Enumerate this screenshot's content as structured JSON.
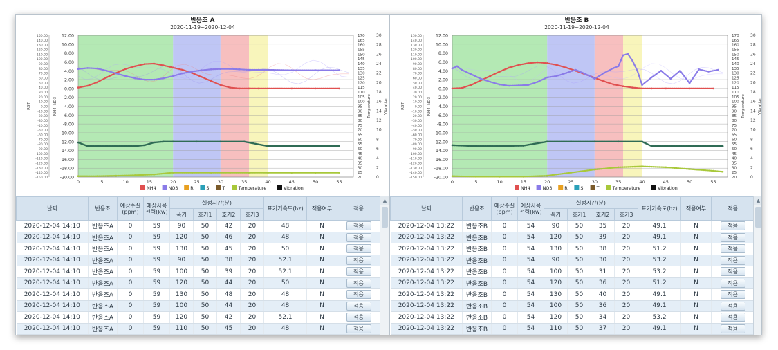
{
  "panels": [
    {
      "chart": {
        "title": "반응조 A",
        "subtitle": "2020-11-19~2020-12-04",
        "y_left_outer_label": "RST",
        "y_left_inner_label": "NH4, NO3",
        "y_right_inner_label": "Temperature",
        "y_right_outer_label": "Vibration"
      },
      "rows": [
        {
          "date": "2020-12-04 14:10",
          "tank": "반응조A",
          "quality": "0",
          "power": "59",
          "aer": "90",
          "anox1": "50",
          "anox2": "42",
          "anox3": "20",
          "freq": "48",
          "applied": "N"
        },
        {
          "date": "2020-12-04 14:10",
          "tank": "반응조A",
          "quality": "0",
          "power": "59",
          "aer": "120",
          "anox1": "50",
          "anox2": "46",
          "anox3": "20",
          "freq": "48",
          "applied": "N"
        },
        {
          "date": "2020-12-04 14:10",
          "tank": "반응조A",
          "quality": "0",
          "power": "59",
          "aer": "130",
          "anox1": "50",
          "anox2": "45",
          "anox3": "20",
          "freq": "50",
          "applied": "N"
        },
        {
          "date": "2020-12-04 14:10",
          "tank": "반응조A",
          "quality": "0",
          "power": "59",
          "aer": "90",
          "anox1": "50",
          "anox2": "38",
          "anox3": "20",
          "freq": "52.1",
          "applied": "N"
        },
        {
          "date": "2020-12-04 14:10",
          "tank": "반응조A",
          "quality": "0",
          "power": "59",
          "aer": "100",
          "anox1": "50",
          "anox2": "39",
          "anox3": "20",
          "freq": "52.1",
          "applied": "N"
        },
        {
          "date": "2020-12-04 14:10",
          "tank": "반응조A",
          "quality": "0",
          "power": "59",
          "aer": "120",
          "anox1": "50",
          "anox2": "44",
          "anox3": "20",
          "freq": "50",
          "applied": "N"
        },
        {
          "date": "2020-12-04 14:10",
          "tank": "반응조A",
          "quality": "0",
          "power": "59",
          "aer": "130",
          "anox1": "50",
          "anox2": "48",
          "anox3": "20",
          "freq": "48",
          "applied": "N"
        },
        {
          "date": "2020-12-04 14:10",
          "tank": "반응조A",
          "quality": "0",
          "power": "59",
          "aer": "100",
          "anox1": "50",
          "anox2": "44",
          "anox3": "20",
          "freq": "48",
          "applied": "N"
        },
        {
          "date": "2020-12-04 14:10",
          "tank": "반응조A",
          "quality": "0",
          "power": "59",
          "aer": "120",
          "anox1": "50",
          "anox2": "42",
          "anox3": "20",
          "freq": "52.1",
          "applied": "N"
        },
        {
          "date": "2020-12-04 14:10",
          "tank": "반응조A",
          "quality": "0",
          "power": "59",
          "aer": "110",
          "anox1": "50",
          "anox2": "45",
          "anox3": "20",
          "freq": "48",
          "applied": "N"
        }
      ]
    },
    {
      "chart": {
        "title": "반응조 B",
        "subtitle": "2020-11-19~2020-12-04",
        "y_left_outer_label": "RST",
        "y_left_inner_label": "NH4, NO3",
        "y_right_inner_label": "Temperature",
        "y_right_outer_label": "Vibration"
      },
      "rows": [
        {
          "date": "2020-12-04 13:22",
          "tank": "반응조B",
          "quality": "0",
          "power": "54",
          "aer": "90",
          "anox1": "50",
          "anox2": "35",
          "anox3": "20",
          "freq": "49.1",
          "applied": "N"
        },
        {
          "date": "2020-12-04 13:22",
          "tank": "반응조B",
          "quality": "0",
          "power": "54",
          "aer": "120",
          "anox1": "50",
          "anox2": "39",
          "anox3": "20",
          "freq": "49.1",
          "applied": "N"
        },
        {
          "date": "2020-12-04 13:22",
          "tank": "반응조B",
          "quality": "0",
          "power": "54",
          "aer": "130",
          "anox1": "50",
          "anox2": "38",
          "anox3": "20",
          "freq": "51.2",
          "applied": "N"
        },
        {
          "date": "2020-12-04 13:22",
          "tank": "반응조B",
          "quality": "0",
          "power": "54",
          "aer": "90",
          "anox1": "50",
          "anox2": "30",
          "anox3": "20",
          "freq": "53.2",
          "applied": "N"
        },
        {
          "date": "2020-12-04 13:22",
          "tank": "반응조B",
          "quality": "0",
          "power": "54",
          "aer": "100",
          "anox1": "50",
          "anox2": "31",
          "anox3": "20",
          "freq": "53.2",
          "applied": "N"
        },
        {
          "date": "2020-12-04 13:22",
          "tank": "반응조B",
          "quality": "0",
          "power": "54",
          "aer": "120",
          "anox1": "50",
          "anox2": "36",
          "anox3": "20",
          "freq": "51.2",
          "applied": "N"
        },
        {
          "date": "2020-12-04 13:22",
          "tank": "반응조B",
          "quality": "0",
          "power": "54",
          "aer": "130",
          "anox1": "50",
          "anox2": "40",
          "anox3": "20",
          "freq": "49.1",
          "applied": "N"
        },
        {
          "date": "2020-12-04 13:22",
          "tank": "반응조B",
          "quality": "0",
          "power": "54",
          "aer": "100",
          "anox1": "50",
          "anox2": "36",
          "anox3": "20",
          "freq": "49.1",
          "applied": "N"
        },
        {
          "date": "2020-12-04 13:22",
          "tank": "반응조B",
          "quality": "0",
          "power": "54",
          "aer": "120",
          "anox1": "50",
          "anox2": "34",
          "anox3": "20",
          "freq": "53.2",
          "applied": "N"
        },
        {
          "date": "2020-12-04 13:22",
          "tank": "반응조B",
          "quality": "0",
          "power": "54",
          "aer": "110",
          "anox1": "50",
          "anox2": "37",
          "anox3": "20",
          "freq": "49.1",
          "applied": "N"
        }
      ]
    }
  ],
  "table_headers": {
    "date": "날짜",
    "tank": "반응조",
    "quality": "예상수질 (ppm)",
    "power": "예상사용 전력(kw)",
    "time_group": "설정시간(분)",
    "aer": "폭기",
    "anox1": "호기1",
    "anox2": "호기2",
    "anox3": "호기3",
    "freq": "표기기속도(hz)",
    "applied": "적용여부",
    "apply": "적용"
  },
  "apply_button_label": "적용",
  "legend": [
    {
      "label": "NH4",
      "color": "#e05050"
    },
    {
      "label": "NO3",
      "color": "#8a7be8"
    },
    {
      "label": "R",
      "color": "#e8a020"
    },
    {
      "label": "S",
      "color": "#2aa0b8"
    },
    {
      "label": "T",
      "color": "#7a5a2a"
    },
    {
      "label": "Temperature",
      "color": "#a8c83a"
    },
    {
      "label": "Vibration",
      "color": "#111111"
    }
  ],
  "phase_bands": [
    {
      "from": 0,
      "to": 20,
      "color": "#9be29b"
    },
    {
      "from": 20,
      "to": 30,
      "color": "#a9b3f2"
    },
    {
      "from": 30,
      "to": 36,
      "color": "#f4a9a9"
    },
    {
      "from": 36,
      "to": 40,
      "color": "#f5f2a4"
    }
  ],
  "axes": {
    "x_ticks": [
      "0",
      "5",
      "10",
      "15",
      "20",
      "25",
      "30",
      "35",
      "40",
      "45",
      "50",
      "55"
    ],
    "x_range": [
      0,
      58
    ],
    "y_inner_ticks": [
      "12.00",
      "10.00",
      "8.00",
      "6.00",
      "4.00",
      "2.00",
      "0.00",
      "-2.00",
      "-4.00",
      "-6.00",
      "-8.00",
      "-10.00",
      "-12.00",
      "-14.00",
      "-16.00",
      "-18.00",
      "-20.00"
    ],
    "y_inner_range": [
      -20,
      12
    ],
    "y_outer_ticks": [
      "150.00",
      "140.00",
      "130.00",
      "120.00",
      "110.00",
      "100.00",
      "90.00",
      "80.00",
      "70.00",
      "60.00",
      "50.00",
      "40.00",
      "30.00",
      "20.00",
      "10.00",
      "0.00",
      "-10.00",
      "-20.00",
      "-30.00",
      "-40.00",
      "-50.00",
      "-60.00",
      "-70.00",
      "-80.00",
      "-90.00",
      "-100.00",
      "-110.00",
      "-120.00",
      "-130.00",
      "-140.00",
      "-150.00"
    ],
    "y_temp_ticks": [
      "170",
      "165",
      "160",
      "155",
      "150",
      "145",
      "140",
      "135",
      "130",
      "125",
      "120",
      "115",
      "110",
      "105",
      "100",
      "95",
      "90",
      "85",
      "80",
      "75",
      "70",
      "65",
      "60",
      "55",
      "50",
      "45",
      "40",
      "35",
      "30",
      "25",
      "20"
    ],
    "y_vib_ticks": [
      "30",
      "28",
      "26",
      "24",
      "22",
      "20",
      "18",
      "16",
      "14",
      "12",
      "10",
      "8",
      "6",
      "4",
      "2",
      "0"
    ]
  },
  "chart_data": [
    {
      "type": "line",
      "title": "반응조 A",
      "subtitle": "2020-11-19~2020-12-04",
      "xlim": [
        0,
        58
      ],
      "ylim": [
        -20,
        12
      ],
      "series": [
        {
          "name": "NH4",
          "x": [
            0,
            2,
            4,
            6,
            8,
            10,
            12,
            14,
            16,
            18,
            20,
            22,
            24,
            26,
            28,
            30,
            32,
            34,
            36,
            38,
            40,
            45,
            50,
            55
          ],
          "values": [
            0.2,
            0.6,
            1.4,
            2.5,
            3.5,
            4.4,
            5.0,
            5.5,
            5.6,
            5.2,
            4.7,
            4.2,
            3.5,
            2.6,
            1.7,
            0.8,
            0.2,
            0.0,
            0.0,
            0.0,
            0.0,
            0.0,
            0.0,
            0.0
          ]
        },
        {
          "name": "NO3",
          "x": [
            0,
            2,
            4,
            6,
            8,
            10,
            12,
            14,
            16,
            18,
            20,
            22,
            24,
            26,
            28,
            30,
            32,
            34,
            36,
            38,
            40,
            45,
            50,
            55
          ],
          "values": [
            4.4,
            4.6,
            4.5,
            4.0,
            3.4,
            2.8,
            2.3,
            2.0,
            2.0,
            2.3,
            2.8,
            3.4,
            3.8,
            4.1,
            4.3,
            4.4,
            4.4,
            4.3,
            4.2,
            4.2,
            4.2,
            4.1,
            4.1,
            4.1
          ]
        },
        {
          "name": "Temperature",
          "x": [
            0,
            4,
            8,
            12,
            16,
            20,
            24,
            28,
            32,
            36,
            40,
            45,
            50,
            55
          ],
          "values": [
            -19.8,
            -19.8,
            -19.7,
            -19.6,
            -19.4,
            -19.0,
            -19.0,
            -19.0,
            -19.0,
            -19.0,
            -19.0,
            -19.0,
            -19.0,
            -19.0
          ]
        },
        {
          "name": "Vibration",
          "x": [
            0,
            2,
            4,
            6,
            8,
            10,
            12,
            14,
            16,
            18,
            20,
            25,
            30,
            35,
            40,
            45,
            50,
            55
          ],
          "values": [
            -12.2,
            -13.0,
            -13.0,
            -13.0,
            -13.0,
            -13.0,
            -13.0,
            -12.8,
            -12.2,
            -12.0,
            -12.0,
            -12.0,
            -12.0,
            -12.0,
            -13.0,
            -13.0,
            -13.0,
            -13.0
          ]
        }
      ]
    },
    {
      "type": "line",
      "title": "반응조 B",
      "subtitle": "2020-11-19~2020-12-04",
      "xlim": [
        0,
        58
      ],
      "ylim": [
        -20,
        12
      ],
      "series": [
        {
          "name": "NH4",
          "x": [
            0,
            2,
            4,
            6,
            8,
            10,
            12,
            14,
            16,
            18,
            20,
            22,
            24,
            26,
            28,
            30,
            32,
            34,
            36,
            38,
            40,
            42,
            45,
            50,
            55
          ],
          "values": [
            0.0,
            0.1,
            0.8,
            1.8,
            2.8,
            3.8,
            4.7,
            5.3,
            5.7,
            5.9,
            5.7,
            5.3,
            4.7,
            4.0,
            3.2,
            2.4,
            1.6,
            0.9,
            0.5,
            0.2,
            0.0,
            0.0,
            0.0,
            0.0,
            0.0
          ]
        },
        {
          "name": "NO3",
          "x": [
            0,
            1,
            2,
            4,
            6,
            8,
            10,
            12,
            14,
            16,
            18,
            20,
            22,
            24,
            26,
            28,
            30,
            32,
            34,
            35,
            36,
            37,
            38,
            39,
            40,
            42,
            44,
            46,
            48,
            50,
            52,
            54,
            56
          ],
          "values": [
            4.5,
            5.0,
            4.2,
            3.2,
            2.2,
            1.5,
            0.9,
            0.6,
            0.7,
            0.8,
            1.5,
            2.5,
            2.8,
            3.5,
            4.2,
            3.3,
            2.2,
            3.5,
            4.6,
            5.0,
            7.5,
            7.8,
            6.2,
            4.0,
            0.8,
            2.5,
            4.0,
            2.2,
            4.0,
            1.2,
            4.3,
            3.8,
            4.2
          ]
        },
        {
          "name": "Temperature",
          "x": [
            0,
            5,
            10,
            15,
            20,
            25,
            30,
            35,
            40,
            45,
            50,
            55,
            57
          ],
          "values": [
            -19.8,
            -19.9,
            -19.9,
            -19.9,
            -19.7,
            -19.0,
            -18.3,
            -17.8,
            -17.6,
            -17.8,
            -18.2,
            -18.6,
            -18.8
          ]
        },
        {
          "name": "Vibration",
          "x": [
            0,
            5,
            10,
            15,
            20,
            25,
            30,
            35,
            40,
            42,
            45,
            50,
            55,
            57
          ],
          "values": [
            -12.8,
            -13.0,
            -13.0,
            -12.9,
            -12.0,
            -12.0,
            -12.0,
            -12.0,
            -12.0,
            -13.0,
            -13.0,
            -13.0,
            -13.0,
            -13.0
          ]
        }
      ]
    }
  ]
}
